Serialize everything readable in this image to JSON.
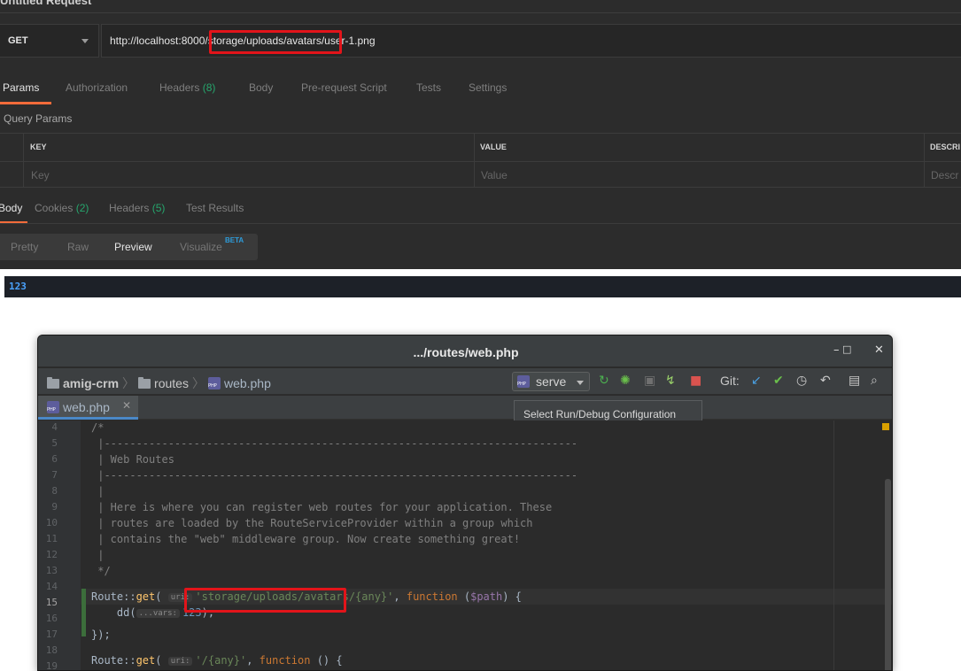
{
  "postman": {
    "title": "Untitled Request",
    "method": "GET",
    "url": "http://localhost:8000/storage/uploads/avatars/user-1.png",
    "request_tabs": [
      {
        "label": "Params",
        "count": ""
      },
      {
        "label": "Authorization",
        "count": ""
      },
      {
        "label": "Headers",
        "count": "(8)"
      },
      {
        "label": "Body",
        "count": ""
      },
      {
        "label": "Pre-request Script",
        "count": ""
      },
      {
        "label": "Tests",
        "count": ""
      },
      {
        "label": "Settings",
        "count": ""
      }
    ],
    "query_params_label": "Query Params",
    "table_headers": [
      "KEY",
      "VALUE",
      "DESCRI"
    ],
    "table_placeholders": [
      "Key",
      "Value",
      "Descr"
    ],
    "response_tabs": [
      {
        "label": "Body",
        "count": ""
      },
      {
        "label": "Cookies",
        "count": "(2)"
      },
      {
        "label": "Headers",
        "count": "(5)"
      },
      {
        "label": "Test Results",
        "count": ""
      }
    ],
    "view_modes": [
      "Pretty",
      "Raw",
      "Preview",
      "Visualize"
    ],
    "view_mode_selected": "Preview",
    "beta_badge": "BETA",
    "preview_output": "123",
    "accent_color": "#f26b3a"
  },
  "ide": {
    "window_title": ".../routes/web.php",
    "window_buttons": {
      "minimize": "–",
      "maximize": "□",
      "close": "✕"
    },
    "breadcrumb": [
      "amig-crm",
      "routes",
      "web.php"
    ],
    "run_config": "serve",
    "git_label": "Git:",
    "tooltip": "Select Run/Debug Configuration",
    "open_tab": "web.php",
    "current_line": "15",
    "lines": [
      {
        "n": "4",
        "text": "/*"
      },
      {
        "n": "5",
        "text": " |--------------------------------------------------------------------------"
      },
      {
        "n": "6",
        "text": " | Web Routes"
      },
      {
        "n": "7",
        "text": " |--------------------------------------------------------------------------"
      },
      {
        "n": "8",
        "text": " |"
      },
      {
        "n": "9",
        "text": " | Here is where you can register web routes for your application. These"
      },
      {
        "n": "10",
        "text": " | routes are loaded by the RouteServiceProvider within a group which"
      },
      {
        "n": "11",
        "text": " | contains the \"web\" middleware group. Now create something great!"
      },
      {
        "n": "12",
        "text": " |"
      },
      {
        "n": "13",
        "text": " */"
      },
      {
        "n": "14",
        "text": ""
      },
      {
        "n": "15",
        "text": ""
      },
      {
        "n": "16",
        "text": ""
      },
      {
        "n": "17",
        "text": "});"
      },
      {
        "n": "18",
        "text": ""
      },
      {
        "n": "19",
        "text": ""
      }
    ],
    "code15": {
      "pre": "Route::",
      "fn": "get",
      "open": "(",
      "hint": "uri:",
      "str": "'storage/uploads/avatars/{any}'",
      "comma": ", ",
      "kw": "function",
      "args": " (",
      "var": "$path",
      "rest": ") {"
    },
    "code16": {
      "pre": "    dd(",
      "hint": "...vars:",
      "num": "123",
      "rest": ");"
    },
    "code19": {
      "pre": "Route::",
      "fn": "get",
      "open": "(",
      "hint": "uri:",
      "str": "'/{any}'",
      "comma": ", ",
      "kw": "function",
      "rest": " () {"
    }
  }
}
